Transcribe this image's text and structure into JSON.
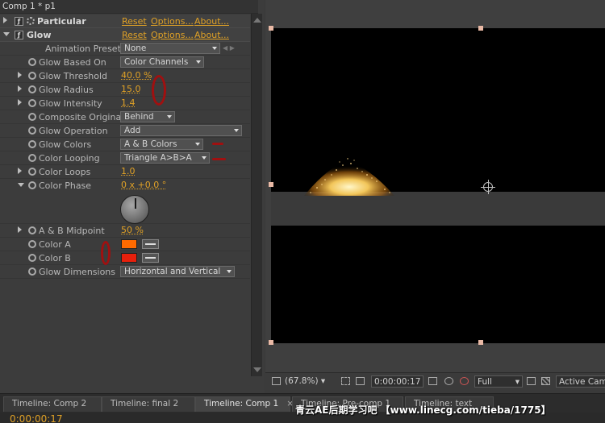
{
  "panel": {
    "title": "Comp 1 * p1"
  },
  "effects": [
    {
      "name": "Particular",
      "reset": "Reset",
      "options": "Options...",
      "about": "About..."
    },
    {
      "name": "Glow",
      "reset": "Reset",
      "options": "Options...",
      "about": "About..."
    }
  ],
  "glow": {
    "animation_presets": {
      "label": "Animation Presets:",
      "value": "None"
    },
    "glow_based_on": {
      "label": "Glow Based On",
      "value": "Color Channels"
    },
    "glow_threshold": {
      "label": "Glow Threshold",
      "value": "40.0 %"
    },
    "glow_radius": {
      "label": "Glow Radius",
      "value": "15.0"
    },
    "glow_intensity": {
      "label": "Glow Intensity",
      "value": "1.4"
    },
    "composite_original": {
      "label": "Composite Original",
      "value": "Behind"
    },
    "glow_operation": {
      "label": "Glow Operation",
      "value": "Add"
    },
    "glow_colors": {
      "label": "Glow Colors",
      "value": "A & B Colors"
    },
    "color_looping": {
      "label": "Color Looping",
      "value": "Triangle A>B>A"
    },
    "color_loops": {
      "label": "Color Loops",
      "value": "1.0"
    },
    "color_phase": {
      "label": "Color Phase",
      "value": "0 x +0.0 °"
    },
    "ab_midpoint": {
      "label": "A & B Midpoint",
      "value": "50 %"
    },
    "color_a": {
      "label": "Color A",
      "value": "#ff6a00"
    },
    "color_b": {
      "label": "Color B",
      "value": "#e8200c"
    },
    "glow_dimensions": {
      "label": "Glow Dimensions",
      "value": "Horizontal and Vertical"
    }
  },
  "viewer": {
    "zoom": "(67.8%)",
    "timecode": "0:00:00:17",
    "resolution": "Full",
    "camera": "Active Came"
  },
  "tabs": [
    {
      "label": "Timeline: Comp 2"
    },
    {
      "label": "Timeline: final 2"
    },
    {
      "label": "Timeline: Comp 1"
    },
    {
      "label": "Timeline: Pre-comp 1"
    },
    {
      "label": "Timeline: text"
    }
  ],
  "timeline": {
    "timecode": "0:00:00:17"
  },
  "watermark": "青云AE后期学习吧  【www.linecg.com/tieba/1775】",
  "colors": {
    "accent": "#e0a126",
    "annotation": "#a01010"
  }
}
